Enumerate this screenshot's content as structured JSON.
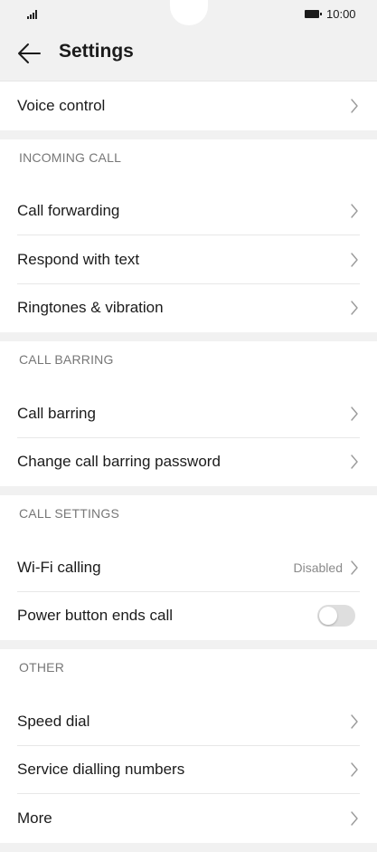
{
  "status_bar": {
    "time": "10:00"
  },
  "header": {
    "title": "Settings"
  },
  "sections": [
    {
      "title": "",
      "rows": [
        {
          "label": "Voice control",
          "control": "chevron"
        }
      ]
    },
    {
      "title": "INCOMING CALL",
      "rows": [
        {
          "label": "Call forwarding",
          "control": "chevron"
        },
        {
          "label": "Respond with text",
          "control": "chevron"
        },
        {
          "label": "Ringtones & vibration",
          "control": "chevron"
        }
      ]
    },
    {
      "title": "CALL BARRING",
      "rows": [
        {
          "label": "Call barring",
          "control": "chevron"
        },
        {
          "label": "Change call barring password",
          "control": "chevron"
        }
      ]
    },
    {
      "title": "CALL SETTINGS",
      "rows": [
        {
          "label": "Wi-Fi calling",
          "value": "Disabled",
          "control": "chevron"
        },
        {
          "label": "Power button ends call",
          "control": "toggle",
          "on": false
        }
      ]
    },
    {
      "title": "OTHER",
      "rows": [
        {
          "label": "Speed dial",
          "control": "chevron"
        },
        {
          "label": "Service dialling numbers",
          "control": "chevron"
        },
        {
          "label": "More",
          "control": "chevron"
        }
      ]
    }
  ]
}
